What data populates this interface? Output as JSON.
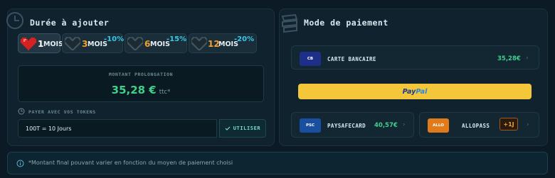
{
  "duration_panel": {
    "title": "Durée à ajouter",
    "options": [
      {
        "months": "1",
        "unit": "MOIS",
        "discount": "",
        "selected": true
      },
      {
        "months": "3",
        "unit": "MOIS",
        "discount": "-10%",
        "selected": false
      },
      {
        "months": "6",
        "unit": "MOIS",
        "discount": "-15%",
        "selected": false
      },
      {
        "months": "12",
        "unit": "MOIS",
        "discount": "-20%",
        "selected": false
      }
    ],
    "amount_label": "MONTANT PROLONGATION",
    "amount_value": "35,28 €",
    "amount_suffix": "ttc*",
    "token_label": "PAYER AVEC VOS TOKENS",
    "token_input_value": "100T = 10 Jours",
    "use_button_label": "UTILISER"
  },
  "payment_panel": {
    "title": "Mode de paiement",
    "methods": {
      "card": {
        "logo": "CB",
        "name": "CARTE BANCAIRE",
        "price": "35,28€"
      },
      "paypal": {
        "pay": "Pay",
        "pal": "Pal"
      },
      "paysafecard": {
        "logo": "PSC",
        "name": "PAYSAFECARD",
        "price": "40,57€"
      },
      "allopass": {
        "logo": "ALLO",
        "name": "ALLOPASS",
        "badge": "+1J"
      }
    }
  },
  "notice": {
    "text": "*Montant final pouvant varier en fonction du moyen de paiement choisi"
  },
  "colors": {
    "background": "#0b1a24",
    "panel": "#0f222e",
    "accent_green": "#3fd08a",
    "accent_orange": "#f0a030",
    "discount_cyan": "#38c8e8",
    "paypal_yellow": "#f4c63a"
  },
  "icons": [
    "clock-icon",
    "heart-icon",
    "wallet-icon",
    "check-icon",
    "chevron-right-icon",
    "info-icon"
  ]
}
